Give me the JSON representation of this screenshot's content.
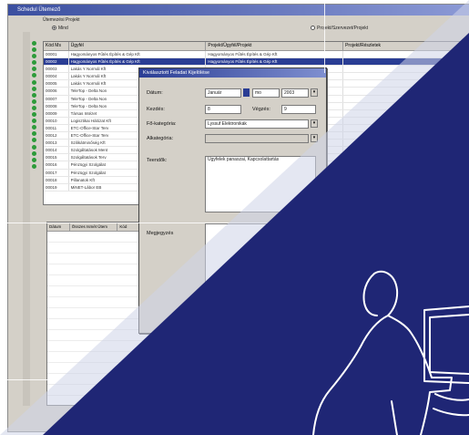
{
  "window": {
    "title": "Schedul Ütemező"
  },
  "filter_group": {
    "label": "Ütemezési Projekt",
    "option_all": "Mind",
    "option_right": "Projekt/Szervezet/Projekt"
  },
  "grid": {
    "columns": [
      "Kód Ms",
      "Ügyfél",
      "Projekt/Ügyfél/Projekt",
      "Projekt/Részletek"
    ],
    "rows": [
      [
        "00001",
        "Hagyományos Fűtés Építés & Gép Kft",
        "Hagyományos Fűtés Építés & Gép Kft",
        ""
      ],
      [
        "00002",
        "Hagyományos Fűtés Építés & Gép Kft",
        "Hagyományos Fűtés Építés & Gép Kft",
        ""
      ],
      [
        "00003",
        "Lakás Y Normál Kft",
        "",
        ""
      ],
      [
        "00004",
        "Lakás Y Normál Kft",
        "",
        ""
      ],
      [
        "00005",
        "Lakás Y Normál Kft",
        "",
        ""
      ],
      [
        "00006",
        "TeleTop - Delta Non",
        "",
        ""
      ],
      [
        "00007",
        "TeleTop - Delta Non",
        "",
        ""
      ],
      [
        "00008",
        "TeleTop - Delta Non",
        "",
        ""
      ],
      [
        "00009",
        "Társas Intézet",
        "",
        ""
      ],
      [
        "00010",
        "Logisztikai Hálózat Kft",
        "",
        ""
      ],
      [
        "00011",
        "ETC-Office-Star Terv",
        "",
        ""
      ],
      [
        "00012",
        "ETC-Office-Star Terv",
        "",
        ""
      ],
      [
        "00013",
        "Szilikátminőség Kft",
        "",
        ""
      ],
      [
        "00014",
        "Szolgáltatások Ment",
        "",
        ""
      ],
      [
        "00015",
        "Szolgáltatások Terv",
        "",
        ""
      ],
      [
        "00016",
        "Pénzügyi Szolgálat",
        "",
        ""
      ],
      [
        "00017",
        "Pénzügyi Szolgálat",
        "",
        ""
      ],
      [
        "00018",
        "Pillanatok Kft",
        "",
        ""
      ],
      [
        "00019",
        "MiNET-Lábor EB",
        "",
        ""
      ]
    ]
  },
  "grid2": {
    "columns": [
      "Dátum",
      "Összes Ismét Ütem",
      "Kód"
    ]
  },
  "dialog": {
    "title": "Kiválasztott Feladat Kijelölése",
    "date_label": "Dátum:",
    "date_month": "Január",
    "date_day": "mo",
    "date_year": "2003",
    "hours_label": "Kezdés:",
    "hours_value": "8",
    "minutes_label": "Végzés:",
    "minutes_value": "9",
    "category_label": "Fő-kategória:",
    "category_value": "Lyssuf Elektronikák",
    "subcategory_label": "Alkategória:",
    "subcategory_value": "",
    "task_label": "Teendők:",
    "task_value": "Ügyfelek panaszai, Kapcsolattartás",
    "note_label": "Megjegyzés"
  },
  "colors": {
    "overlay_blue": "#1f2675",
    "accent": "#2a3d94",
    "marker": "#2d9b3a"
  }
}
